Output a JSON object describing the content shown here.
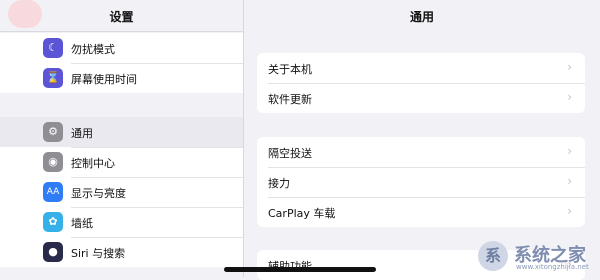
{
  "sidebar": {
    "title": "设置",
    "group1": [
      {
        "label": "勿扰模式",
        "icon": "moon-icon",
        "glyph": "☾",
        "color": "#5b55d6"
      },
      {
        "label": "屏幕使用时间",
        "icon": "hourglass-icon",
        "glyph": "⌛",
        "color": "#5b55d6"
      }
    ],
    "group2": [
      {
        "label": "通用",
        "icon": "gear-icon",
        "glyph": "⚙",
        "color": "#8e8e93"
      },
      {
        "label": "控制中心",
        "icon": "toggles-icon",
        "glyph": "◉",
        "color": "#8e8e93"
      },
      {
        "label": "显示与亮度",
        "icon": "text-size-icon",
        "glyph": "AA",
        "color": "#2f7cf6"
      },
      {
        "label": "墙纸",
        "icon": "flower-icon",
        "glyph": "✿",
        "color": "#35b0e8"
      },
      {
        "label": "Siri 与搜索",
        "icon": "siri-icon",
        "glyph": "●",
        "color": "#2a2a4a"
      }
    ]
  },
  "main": {
    "title": "通用",
    "cards": [
      [
        {
          "label": "关于本机"
        },
        {
          "label": "软件更新"
        }
      ],
      [
        {
          "label": "隔空投送"
        },
        {
          "label": "接力"
        },
        {
          "label": "CarPlay 车载"
        }
      ],
      [
        {
          "label": "辅助功能"
        }
      ]
    ]
  },
  "watermark": {
    "logo": "系",
    "text": "系统之家",
    "url": "www.xitongzhijia.net"
  }
}
